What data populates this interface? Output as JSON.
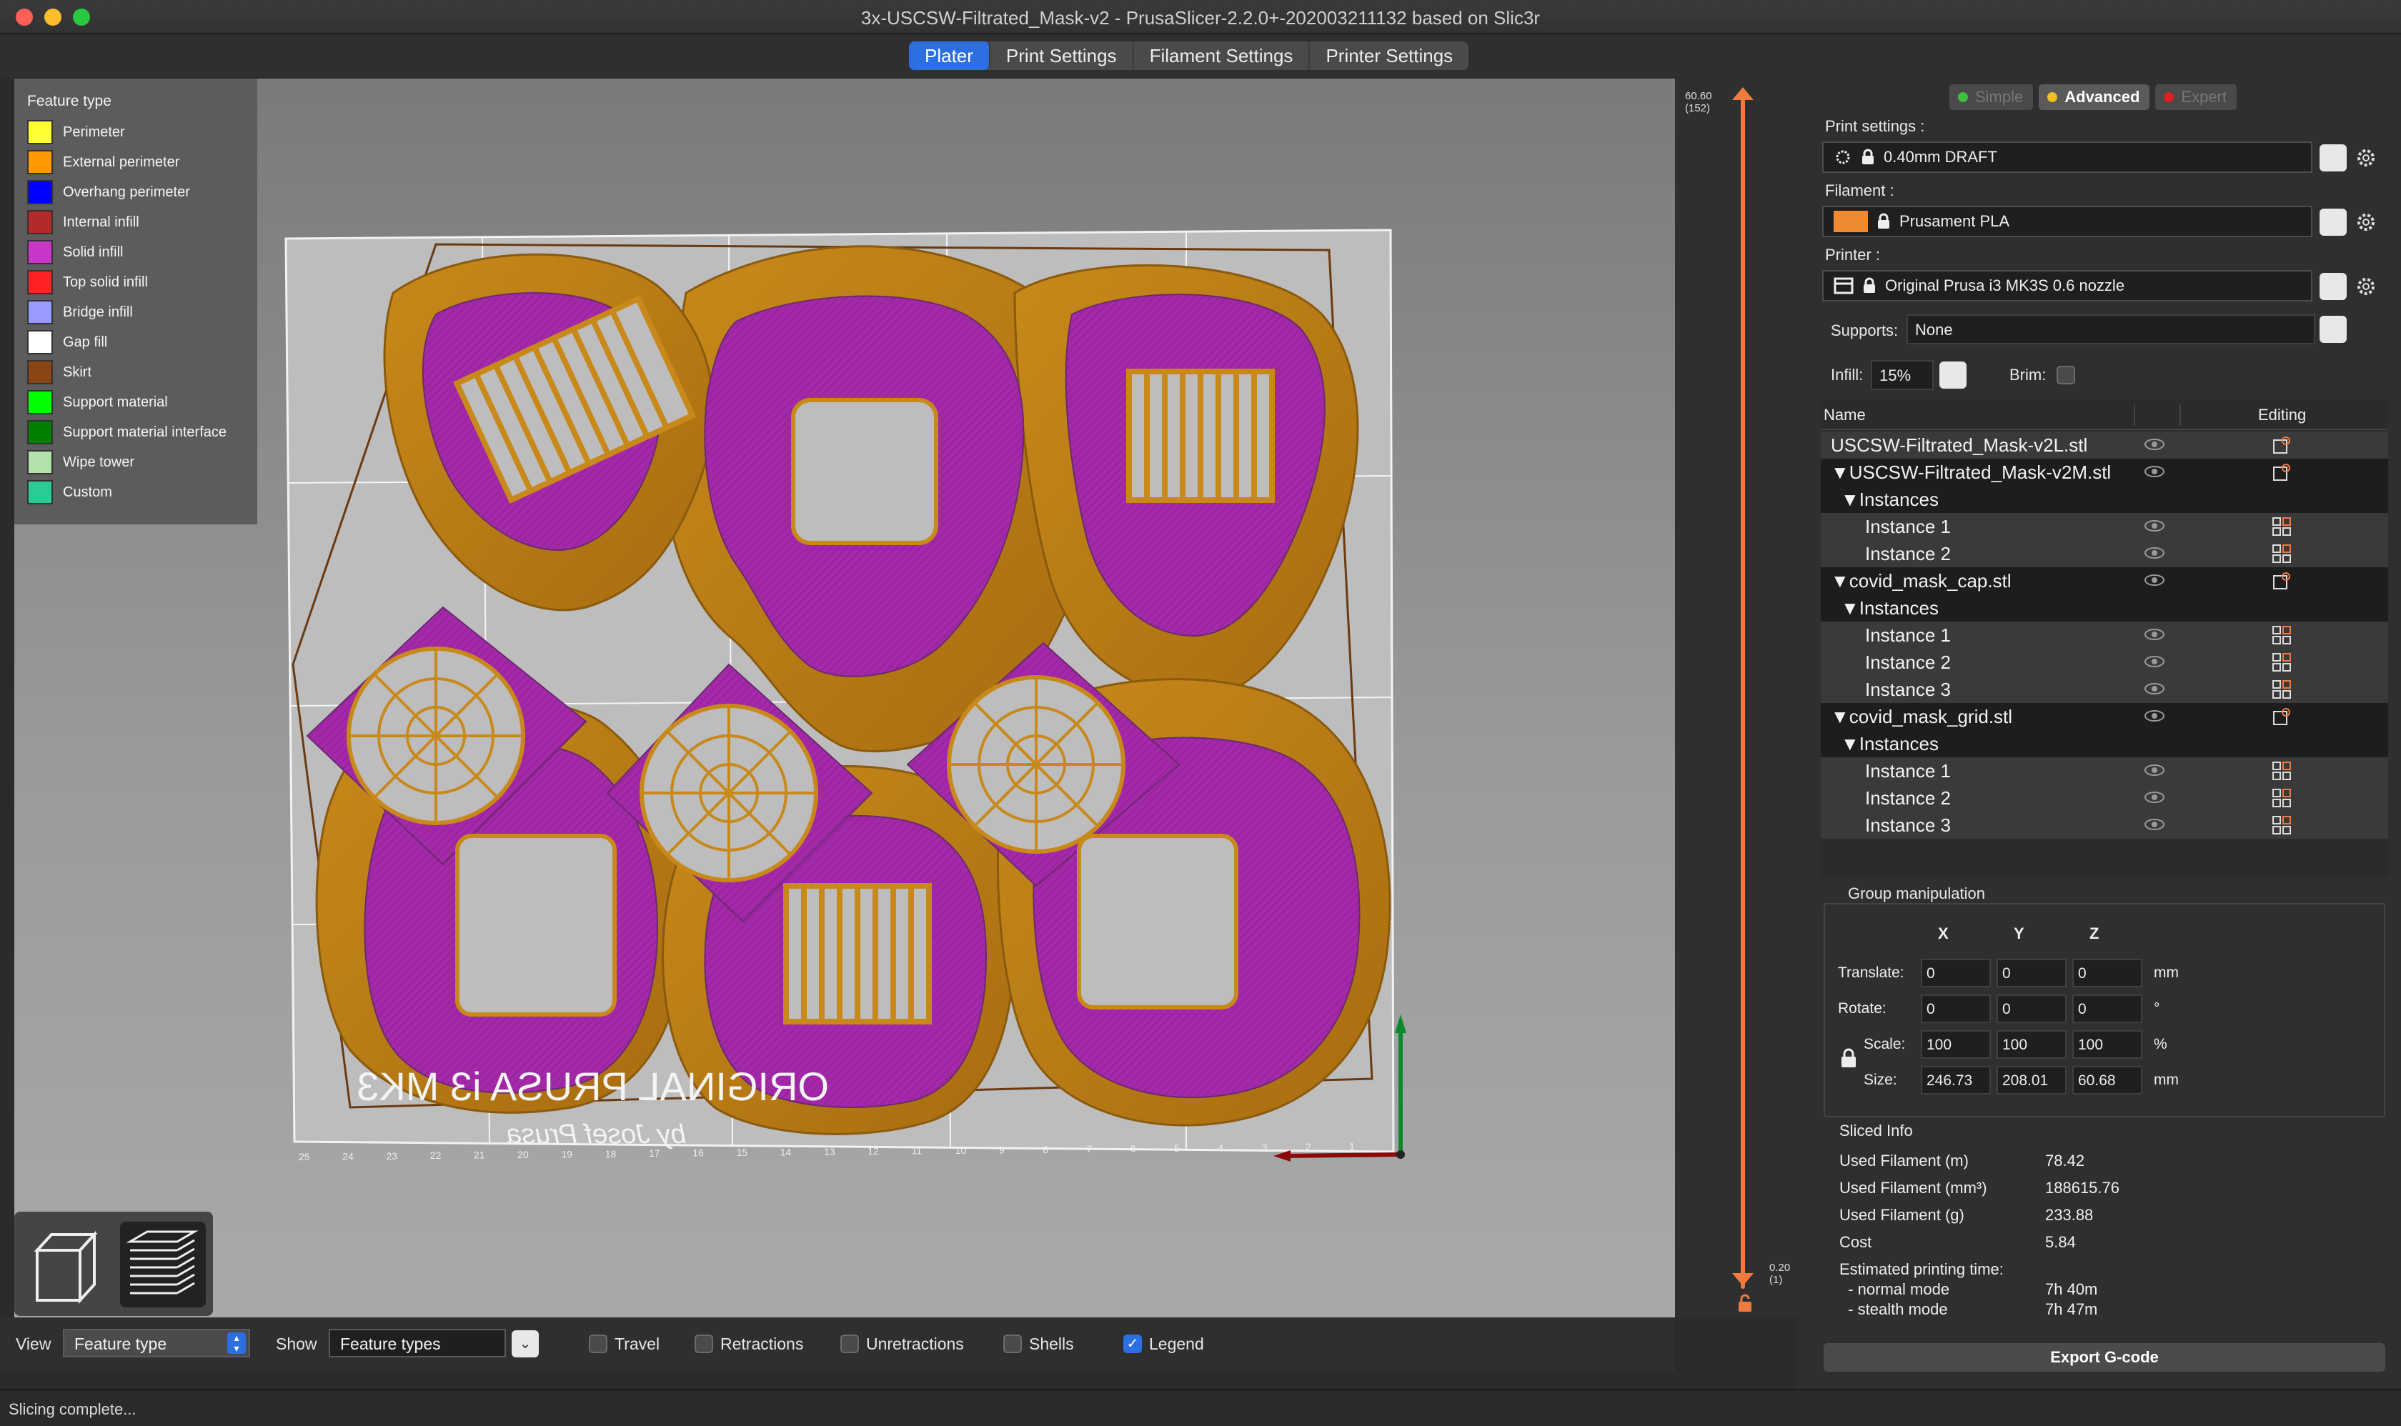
{
  "window": {
    "title": "3x-USCSW-Filtrated_Mask-v2 - PrusaSlicer-2.2.0+-202003211132 based on Slic3r"
  },
  "tabs": [
    {
      "label": "Plater",
      "active": true
    },
    {
      "label": "Print Settings",
      "active": false
    },
    {
      "label": "Filament Settings",
      "active": false
    },
    {
      "label": "Printer Settings",
      "active": false
    }
  ],
  "legend": {
    "title": "Feature type",
    "items": [
      {
        "label": "Perimeter",
        "color": "#ffff33"
      },
      {
        "label": "External perimeter",
        "color": "#ff9900"
      },
      {
        "label": "Overhang perimeter",
        "color": "#0000ff"
      },
      {
        "label": "Internal infill",
        "color": "#b22a2a"
      },
      {
        "label": "Solid infill",
        "color": "#c837c8"
      },
      {
        "label": "Top solid infill",
        "color": "#ff2222"
      },
      {
        "label": "Bridge infill",
        "color": "#9999ff"
      },
      {
        "label": "Gap fill",
        "color": "#ffffff"
      },
      {
        "label": "Skirt",
        "color": "#8b4513"
      },
      {
        "label": "Support material",
        "color": "#00ff00"
      },
      {
        "label": "Support material interface",
        "color": "#008000"
      },
      {
        "label": "Wipe tower",
        "color": "#b3e3ab"
      },
      {
        "label": "Custom",
        "color": "#28cc94"
      }
    ]
  },
  "bed": {
    "logo_line1": "ORIGINAL PRUSA i3 MK3",
    "logo_line2": "by Josef Prusa",
    "x_ticks": [
      "25",
      "24",
      "23",
      "22",
      "21",
      "20",
      "19",
      "18",
      "17",
      "16",
      "15",
      "14",
      "13",
      "12",
      "11",
      "10",
      "9",
      "8",
      "7",
      "6",
      "5",
      "4",
      "3",
      "2",
      "1"
    ]
  },
  "layer_slider": {
    "top_value": "60.60",
    "top_layer": "(152)",
    "bottom_value": "0.20",
    "bottom_layer": "(1)"
  },
  "bottom_bar": {
    "view_label": "View",
    "view_value": "Feature type",
    "show_label": "Show",
    "show_value": "Feature types",
    "checks": [
      {
        "label": "Travel",
        "checked": false
      },
      {
        "label": "Retractions",
        "checked": false
      },
      {
        "label": "Unretractions",
        "checked": false
      },
      {
        "label": "Shells",
        "checked": false
      },
      {
        "label": "Legend",
        "checked": true
      }
    ]
  },
  "status": "Slicing complete...",
  "modes": [
    {
      "label": "Simple",
      "dot": "#3fbf3f",
      "active": false
    },
    {
      "label": "Advanced",
      "dot": "#f0c020",
      "active": true
    },
    {
      "label": "Expert",
      "dot": "#e02020",
      "active": false
    }
  ],
  "print_settings": {
    "label": "Print settings :",
    "value": "0.40mm DRAFT"
  },
  "filament": {
    "label": "Filament :",
    "value": "Prusament PLA",
    "color": "#f08a30"
  },
  "printer": {
    "label": "Printer :",
    "value": "Original Prusa i3 MK3S 0.6 nozzle"
  },
  "supports": {
    "label": "Supports:",
    "value": "None"
  },
  "infill": {
    "label": "Infill:",
    "value": "15%"
  },
  "brim": {
    "label": "Brim:",
    "checked": false
  },
  "object_list": {
    "col_name": "Name",
    "col_editing": "Editing",
    "rows": [
      {
        "text": "USCSW-Filtrated_Mask-v2L.stl",
        "indent": 0,
        "style": "grey",
        "eye": true,
        "edit": "settings"
      },
      {
        "text": "▼USCSW-Filtrated_Mask-v2M.stl",
        "indent": 0,
        "style": "dark",
        "eye": true,
        "edit": "settings"
      },
      {
        "text": "▼Instances",
        "indent": 1,
        "style": "dark",
        "eye": false,
        "edit": ""
      },
      {
        "text": "Instance 1",
        "indent": 2,
        "style": "grey",
        "eye": true,
        "edit": "instance"
      },
      {
        "text": "Instance 2",
        "indent": 2,
        "style": "grey",
        "eye": true,
        "edit": "instance"
      },
      {
        "text": "▼covid_mask_cap.stl",
        "indent": 0,
        "style": "dark",
        "eye": true,
        "edit": "settings"
      },
      {
        "text": "▼Instances",
        "indent": 1,
        "style": "dark",
        "eye": false,
        "edit": ""
      },
      {
        "text": "Instance 1",
        "indent": 2,
        "style": "grey",
        "eye": true,
        "edit": "instance"
      },
      {
        "text": "Instance 2",
        "indent": 2,
        "style": "grey",
        "eye": true,
        "edit": "instance"
      },
      {
        "text": "Instance 3",
        "indent": 2,
        "style": "grey",
        "eye": true,
        "edit": "instance"
      },
      {
        "text": "▼covid_mask_grid.stl",
        "indent": 0,
        "style": "dark",
        "eye": true,
        "edit": "settings"
      },
      {
        "text": "▼Instances",
        "indent": 1,
        "style": "dark",
        "eye": false,
        "edit": ""
      },
      {
        "text": "Instance 1",
        "indent": 2,
        "style": "grey",
        "eye": true,
        "edit": "instance"
      },
      {
        "text": "Instance 2",
        "indent": 2,
        "style": "grey",
        "eye": true,
        "edit": "instance"
      },
      {
        "text": "Instance 3",
        "indent": 2,
        "style": "grey",
        "eye": true,
        "edit": "instance"
      }
    ]
  },
  "group_manipulation": {
    "title": "Group manipulation",
    "axes": [
      "X",
      "Y",
      "Z"
    ],
    "rows": [
      {
        "label": "Translate:",
        "values": [
          "0",
          "0",
          "0"
        ],
        "unit": "mm"
      },
      {
        "label": "Rotate:",
        "values": [
          "0",
          "0",
          "0"
        ],
        "unit": "°"
      },
      {
        "label": "Scale:",
        "values": [
          "100",
          "100",
          "100"
        ],
        "unit": "%"
      },
      {
        "label": "Size:",
        "values": [
          "246.73",
          "208.01",
          "60.68"
        ],
        "unit": "mm"
      }
    ]
  },
  "sliced_info": {
    "title": "Sliced Info",
    "rows": [
      {
        "label": "Used Filament (m)",
        "value": "78.42"
      },
      {
        "label": "Used Filament (mm³)",
        "value": "188615.76"
      },
      {
        "label": "Used Filament (g)",
        "value": "233.88"
      },
      {
        "label": "Cost",
        "value": "5.84"
      },
      {
        "label": "Estimated printing time:",
        "value": ""
      },
      {
        "label": "  - normal mode",
        "value": "7h 40m"
      },
      {
        "label": "  - stealth mode",
        "value": "7h 47m"
      }
    ]
  },
  "export_label": "Export G-code"
}
